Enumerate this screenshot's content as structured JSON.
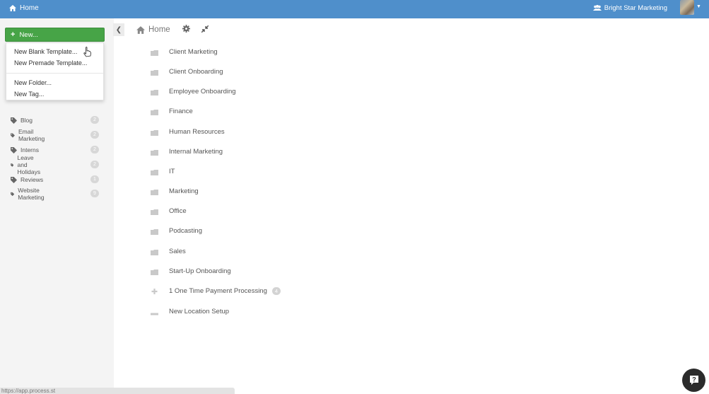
{
  "topbar": {
    "home_label": "Home",
    "org_name": "Bright Star Marketing",
    "color": "#4f8fcb"
  },
  "sidebar": {
    "new_button_label": "New...",
    "new_menu": {
      "items": [
        "New Blank Template...",
        "New Premade Template...",
        "New Folder...",
        "New Tag..."
      ]
    },
    "tags": [
      {
        "label": "Blog",
        "count": "2"
      },
      {
        "label": "Email Marketing",
        "count": "2"
      },
      {
        "label": "Interns",
        "count": "2"
      },
      {
        "label": "Leave and Holidays",
        "count": "2"
      },
      {
        "label": "Reviews",
        "count": "1"
      },
      {
        "label": "Website Marketing",
        "count": "9"
      }
    ]
  },
  "main": {
    "breadcrumb": "Home",
    "folders": [
      {
        "label": "Client Marketing",
        "icon": "folder-icon"
      },
      {
        "label": "Client Onboarding",
        "icon": "folder-icon"
      },
      {
        "label": "Employee Onboarding",
        "icon": "folder-icon"
      },
      {
        "label": "Finance",
        "icon": "folder-icon"
      },
      {
        "label": "Human Resources",
        "icon": "folder-icon"
      },
      {
        "label": "Internal Marketing",
        "icon": "folder-icon"
      },
      {
        "label": "IT",
        "icon": "folder-icon"
      },
      {
        "label": "Marketing",
        "icon": "folder-icon"
      },
      {
        "label": "Office",
        "icon": "folder-icon"
      },
      {
        "label": "Podcasting",
        "icon": "folder-icon"
      },
      {
        "label": "Sales",
        "icon": "folder-icon"
      },
      {
        "label": "Start-Up Onboarding",
        "icon": "folder-icon"
      },
      {
        "label": "1 One Time Payment Processing",
        "icon": "plus-icon",
        "badge": "4"
      },
      {
        "label": "New Location Setup",
        "icon": "minus-icon"
      }
    ]
  },
  "status_bar_url": "https://app.process.st",
  "colors": {
    "new_button": "#47a447",
    "sidebar_bg": "#f4f4f4"
  }
}
